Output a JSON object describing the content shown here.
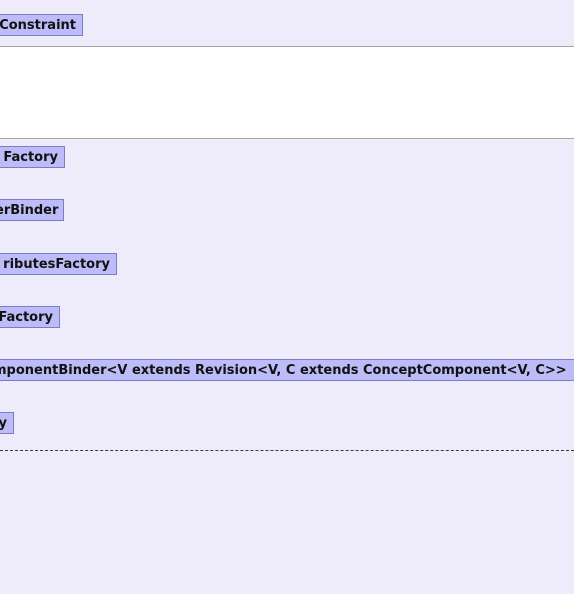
{
  "diagram": {
    "header_node": {
      "label": "Constraint"
    },
    "nodes": [
      {
        "label": "Factory"
      },
      {
        "label": "erBinder"
      },
      {
        "label": "ributesFactory"
      },
      {
        "label": "Factory"
      },
      {
        "label": "mponentBinder<V extends Revision<V, C extends ConceptComponent<V, C>>"
      },
      {
        "label": "y"
      }
    ]
  },
  "colors": {
    "background": "#eeecfb",
    "white_band": "#ffffff",
    "node_fill": "#bcbcf8",
    "node_border": "#7c7cc0",
    "divider": "#3a3a3a"
  }
}
